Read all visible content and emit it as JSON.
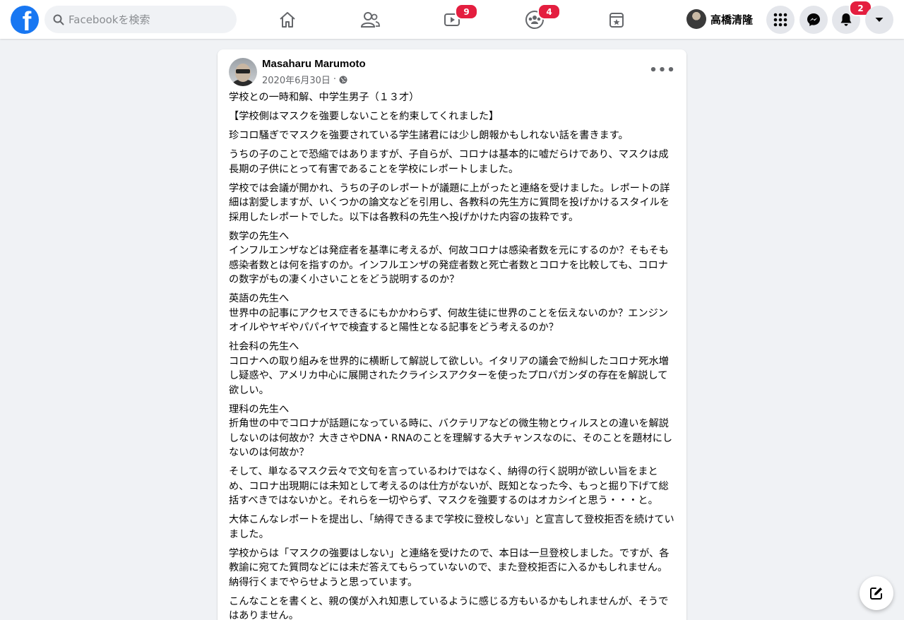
{
  "search": {
    "placeholder": "Facebookを検索"
  },
  "nav": {
    "tabs": [
      {
        "name": "home",
        "badge": ""
      },
      {
        "name": "friends",
        "badge": ""
      },
      {
        "name": "watch",
        "badge": "9"
      },
      {
        "name": "groups",
        "badge": "4"
      },
      {
        "name": "gaming",
        "badge": ""
      }
    ]
  },
  "account": {
    "name": "高橋清隆",
    "notifications_badge": "2"
  },
  "icons": [
    "search-icon",
    "home-icon",
    "friends-icon",
    "watch-icon",
    "groups-icon",
    "gaming-icon",
    "menu-grid-icon",
    "messenger-icon",
    "bell-icon",
    "caret-down-icon",
    "globe-icon",
    "more-dots-icon",
    "compose-icon"
  ],
  "colors": {
    "brand": "#1877f2",
    "badge": "#e41e3f",
    "icon_gray": "#65676b",
    "background": "#f0f2f5"
  },
  "post": {
    "author": "Masaharu Marumoto",
    "date": "2020年6月30日",
    "separator": "·",
    "more": "•••",
    "paragraphs": [
      "学校との一時和解、中学生男子（１３才）",
      "【学校側はマスクを強要しないことを約束してくれました】",
      "珍コロ騒ぎでマスクを強要されている学生諸君には少し朗報かもしれない話を書きます。",
      "うちの子のことで恐縮ではありますが、子自らが、コロナは基本的に嘘だらけであり、マスクは成長期の子供にとって有害であることを学校にレポートしました。",
      "学校では会議が開かれ、うちの子のレポートが議題に上がったと連絡を受けました。レポートの詳細は割愛しますが、いくつかの論文などを引用し、各教科の先生方に質問を投げかけるスタイルを採用したレポートでした。以下は各教科の先生へ投げかけた内容の抜粋です。",
      "数学の先生へ\nインフルエンザなどは発症者を基準に考えるが、何故コロナは感染者数を元にするのか？そもそも感染者数とは何を指すのか。インフルエンザの発症者数と死亡者数とコロナを比較しても、コロナの数字がもの凄く小さいことをどう説明するのか？",
      "英語の先生へ\n世界中の記事にアクセスできるにもかかわらず、何故生徒に世界のことを伝えないのか？エンジンオイルやヤギやパパイヤで検査すると陽性となる記事をどう考えるのか？",
      "社会科の先生へ\nコロナへの取り組みを世界的に横断して解説して欲しい。イタリアの議会で紛糾したコロナ死水増し疑惑や、アメリカ中心に展開されたクライシスアクターを使ったプロパガンダの存在を解説して欲しい。",
      "理科の先生へ\n折角世の中でコロナが話題になっている時に、バクテリアなどの微生物とウィルスとの違いを解説しないのは何故か？大きさやDNA・RNAのことを理解する大チャンスなのに、そのことを題材にしないのは何故か？",
      "そして、単なるマスク云々で文句を言っているわけではなく、納得の行く説明が欲しい旨をまとめ、コロナ出現期には未知として考えるのは仕方がないが、既知となった今、もっと掘り下げて総括すべきではないかと。それらを一切やらず、マスクを強要するのはオカシイと思う・・・と。",
      "大体こんなレポートを提出し、「納得できるまで学校に登校しない」と宣言して登校拒否を続けていました。",
      "学校からは「マスクの強要はしない」と連絡を受けたので、本日は一旦登校しました。ですが、各教諭に宛てた質問などには未だ答えてもらっていないので、また登校拒否に入るかもしれません。納得行くまでやらせようと思っています。",
      "こんなことを書くと、親の僕が入れ知恵しているように感じる方もいるかもしれませんが、そうではありません。"
    ]
  }
}
